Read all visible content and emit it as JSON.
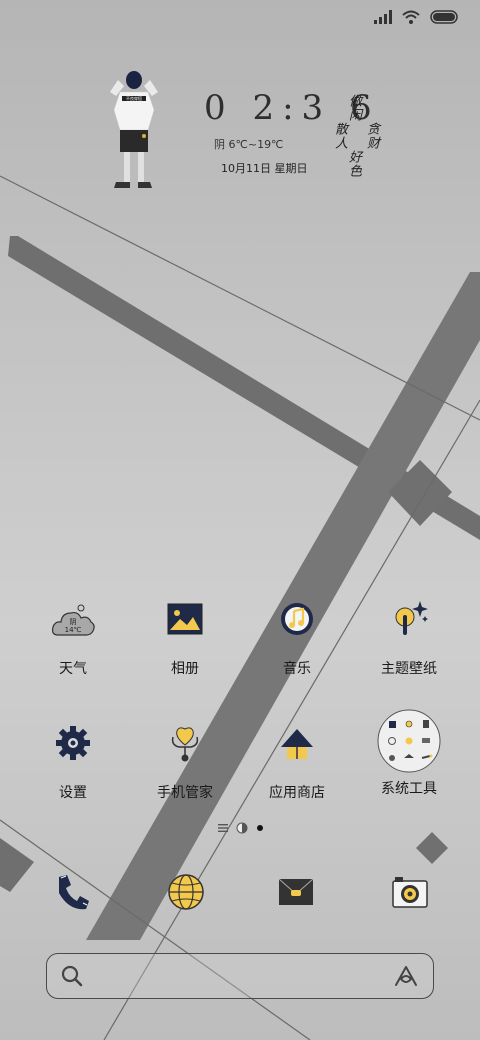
{
  "status": {
    "icons": [
      "signal-icon",
      "wifi-icon",
      "battery-icon"
    ]
  },
  "widget": {
    "time": "0 2:3 6",
    "weather": "阴 6℃~19℃",
    "date": "10月11日 星期日",
    "signature_columns": [
      "做闲",
      "散人",
      "贪财",
      "好色"
    ],
    "figure_shirt_text": "不良穿搭"
  },
  "apps": [
    {
      "label": "天气",
      "icon": "weather-icon",
      "icon_text_top": "阴",
      "icon_text_bottom": "14℃"
    },
    {
      "label": "相册",
      "icon": "gallery-icon"
    },
    {
      "label": "音乐",
      "icon": "music-icon"
    },
    {
      "label": "主题壁纸",
      "icon": "themes-icon"
    },
    {
      "label": "设置",
      "icon": "settings-icon"
    },
    {
      "label": "手机管家",
      "icon": "security-icon"
    },
    {
      "label": "应用商店",
      "icon": "app-store-icon"
    },
    {
      "label": "系统工具",
      "icon": "system-tools-folder-icon"
    }
  ],
  "page_indicator": {
    "pages": 2,
    "current": 2
  },
  "dock": [
    {
      "icon": "phone-icon"
    },
    {
      "icon": "browser-icon"
    },
    {
      "icon": "messages-icon"
    },
    {
      "icon": "camera-icon"
    }
  ],
  "search": {
    "placeholder": ""
  },
  "colors": {
    "accent": "#f2c94c",
    "navy": "#1f2a48",
    "stripe": "#7a7a7a"
  }
}
